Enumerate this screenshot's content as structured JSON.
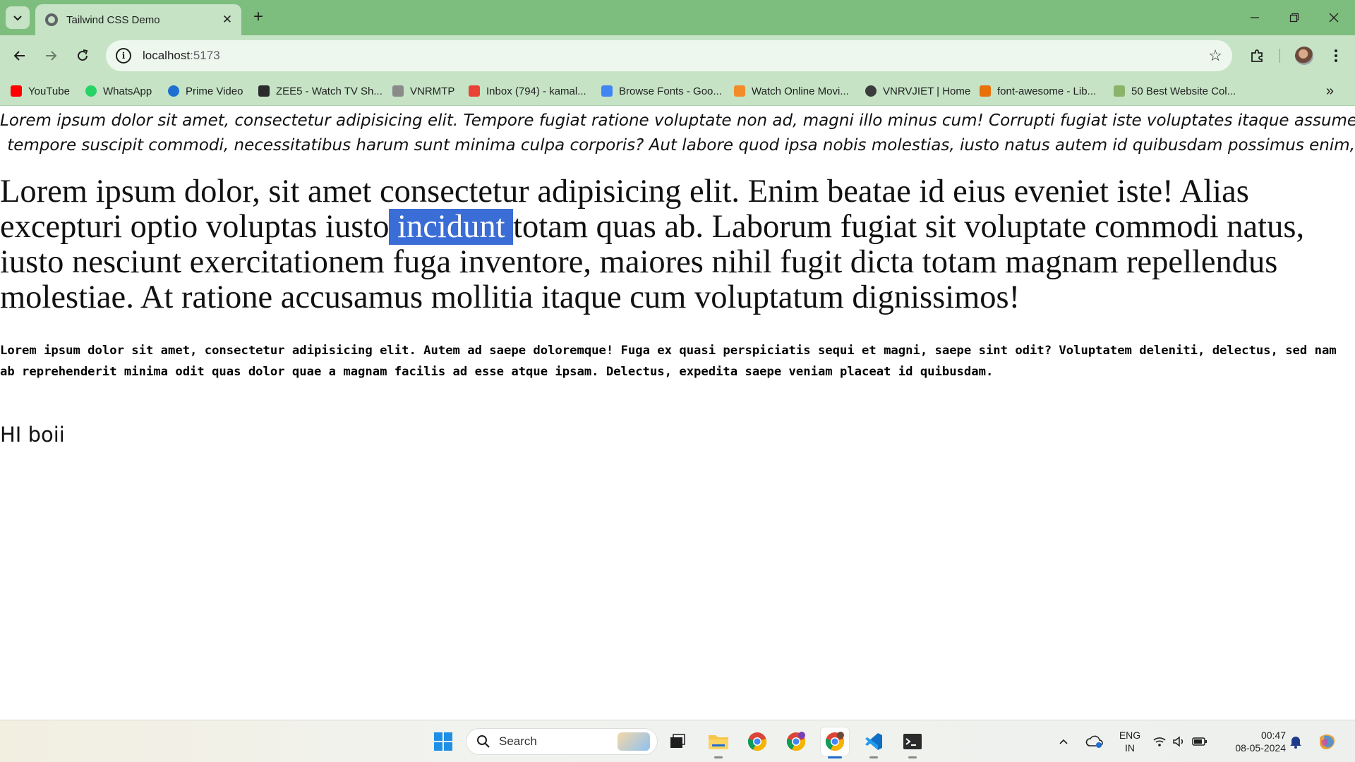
{
  "browser": {
    "tab_title": "Tailwind CSS Demo",
    "url_host": "localhost",
    "url_port": ":5173",
    "bookmarks": [
      {
        "label": "YouTube",
        "color": "#ff0000"
      },
      {
        "label": "WhatsApp",
        "color": "#25d366"
      },
      {
        "label": "Prime Video",
        "color": "#1f6fd1"
      },
      {
        "label": "ZEE5 - Watch TV Sh...",
        "color": "#2b2b2b"
      },
      {
        "label": "VNRMTP",
        "color": "#8a8a8a"
      },
      {
        "label": "Inbox (794) - kamal...",
        "color": "#ea4335"
      },
      {
        "label": "Browse Fonts - Goo...",
        "color": "#4285f4"
      },
      {
        "label": "Watch Online Movi...",
        "color": "#f28c28"
      },
      {
        "label": "VNRVJIET | Home",
        "color": "#3c3c3c"
      },
      {
        "label": "font-awesome - Lib...",
        "color": "#e8710a"
      },
      {
        "label": "50 Best Website Col...",
        "color": "#8bb36a"
      }
    ]
  },
  "page": {
    "italic_line1": "Lorem ipsum dolor sit amet, consectetur adipisicing elit. Tempore fugiat ratione voluptate non ad, magni illo minus cum! Corrupti fugiat iste voluptates itaque assumenda",
    "italic_line2": "tempore suscipit commodi, necessitatibus harum sunt minima culpa corporis? Aut labore quod ipsa nobis molestias, iusto natus autem id quibusdam possimus enim,",
    "serif_before": "Lorem ipsum dolor, sit amet consectetur adipisicing elit. Enim beatae id eius eveniet iste! Alias excepturi optio voluptas iusto",
    "serif_selected": " incidunt ",
    "serif_after": "totam quas ab. Laborum fugiat sit voluptate commodi natus, iusto nesciunt exercitationem fuga inventore, maiores nihil fugit dicta totam magnam repellendus molestiae. At ratione accusamus mollitia itaque cum voluptatum dignissimos!",
    "mono_paragraph": "Lorem ipsum dolor sit amet, consectetur adipisicing elit. Autem ad saepe doloremque! Fuga ex quasi perspiciatis sequi et magni, saepe sint odit? Voluptatem deleniti, delectus, sed nam ab reprehenderit minima odit quas dolor quae a magnam facilis ad esse atque ipsam. Delectus, expedita saepe veniam placeat id quibusdam.",
    "heading": "HI boii"
  },
  "taskbar": {
    "search_label": "Search",
    "lang_line1": "ENG",
    "lang_line2": "IN",
    "time": "00:47",
    "date": "08-05-2024"
  },
  "colors": {
    "titlebar": "#7dbd7e",
    "toolbar": "#c6e3c6",
    "selection": "#3b6dd6"
  }
}
